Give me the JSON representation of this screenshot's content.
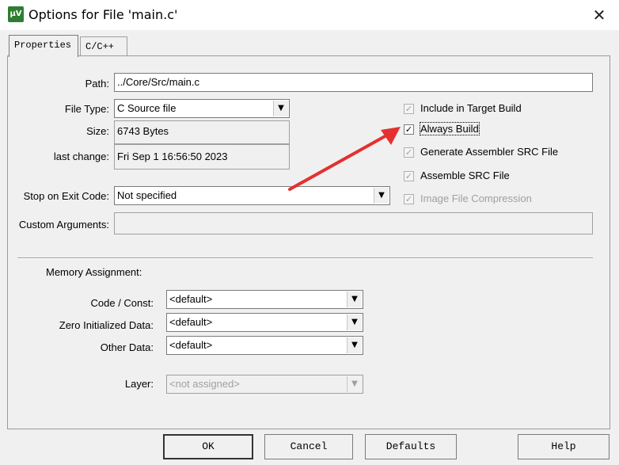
{
  "window": {
    "title": "Options for File 'main.c'",
    "icon": "uv-app-icon",
    "icon_text": "µV"
  },
  "tabs": [
    {
      "label": "Properties"
    },
    {
      "label": "C/C++"
    }
  ],
  "props": {
    "path_label": "Path:",
    "path_value": "../Core/Src/main.c",
    "filetype_label": "File Type:",
    "filetype_value": "C Source file",
    "size_label": "Size:",
    "size_value": "6743 Bytes",
    "lastchange_label": "last change:",
    "lastchange_value": "Fri Sep  1 16:56:50 2023",
    "stop_label": "Stop on Exit Code:",
    "stop_value": "Not specified",
    "custom_label": "Custom Arguments:",
    "custom_value": ""
  },
  "checks": [
    {
      "label": "Include in Target Build",
      "checked": true,
      "enabled": false
    },
    {
      "label": "Always Build",
      "checked": true,
      "enabled": true
    },
    {
      "label": "Generate Assembler SRC File",
      "checked": true,
      "enabled": false
    },
    {
      "label": "Assemble SRC File",
      "checked": true,
      "enabled": false
    },
    {
      "label": "Image File Compression",
      "checked": true,
      "enabled": false
    }
  ],
  "memory": {
    "heading": "Memory Assignment:",
    "code_label": "Code / Const:",
    "code_value": "<default>",
    "zero_label": "Zero Initialized Data:",
    "zero_value": "<default>",
    "other_label": "Other Data:",
    "other_value": "<default>",
    "layer_label": "Layer:",
    "layer_value": "<not assigned>"
  },
  "buttons": {
    "ok": "OK",
    "cancel": "Cancel",
    "defaults": "Defaults",
    "help": "Help"
  },
  "annotation": {
    "arrow_color": "#e53030"
  }
}
